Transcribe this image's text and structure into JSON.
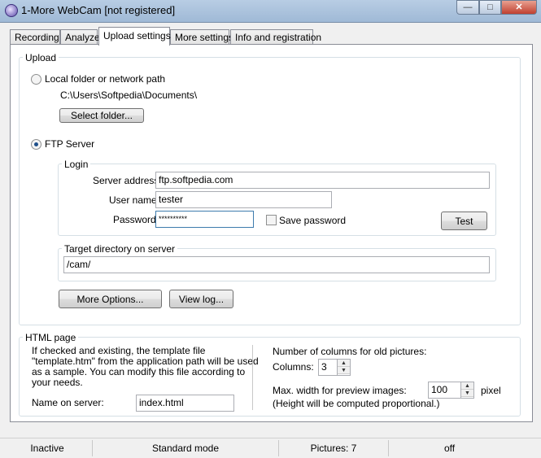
{
  "window": {
    "title": "1-More WebCam [not registered]"
  },
  "tabs": [
    "Recording",
    "Analyze",
    "Upload settings",
    "More settings",
    "Info and registration"
  ],
  "upload": {
    "legend": "Upload",
    "local_label": "Local folder or network path",
    "local_path": "C:\\Users\\Softpedia\\Documents\\",
    "select_folder": "Select folder...",
    "ftp_label": "FTP Server",
    "login": {
      "legend": "Login",
      "server_label": "Server address:",
      "server_value": "ftp.softpedia.com",
      "user_label": "User name:",
      "user_value": "tester",
      "password_label": "Password:",
      "password_value": "**********",
      "save_password": "Save password",
      "test": "Test"
    },
    "target": {
      "legend": "Target directory on server",
      "value": "/cam/"
    },
    "more_options": "More Options...",
    "view_log": "View log..."
  },
  "html_page": {
    "legend": "HTML page",
    "desc_line1": "If checked and existing, the template file",
    "desc_line2": "\"template.htm\" from the application path will be used",
    "desc_line3": "as a sample. You can modify this file according to",
    "desc_line4": "your needs.",
    "name_label": "Name on server:",
    "name_value": "index.html",
    "columns_title": "Number of columns for old pictures:",
    "columns_label": "Columns:",
    "columns_value": "3",
    "maxwidth_label": "Max. width for preview images:",
    "maxwidth_value": "100",
    "maxwidth_unit": "pixel",
    "maxwidth_note": "(Height will be computed proportional.)"
  },
  "status": [
    "Inactive",
    "Standard mode",
    "Pictures: 7",
    "off"
  ]
}
